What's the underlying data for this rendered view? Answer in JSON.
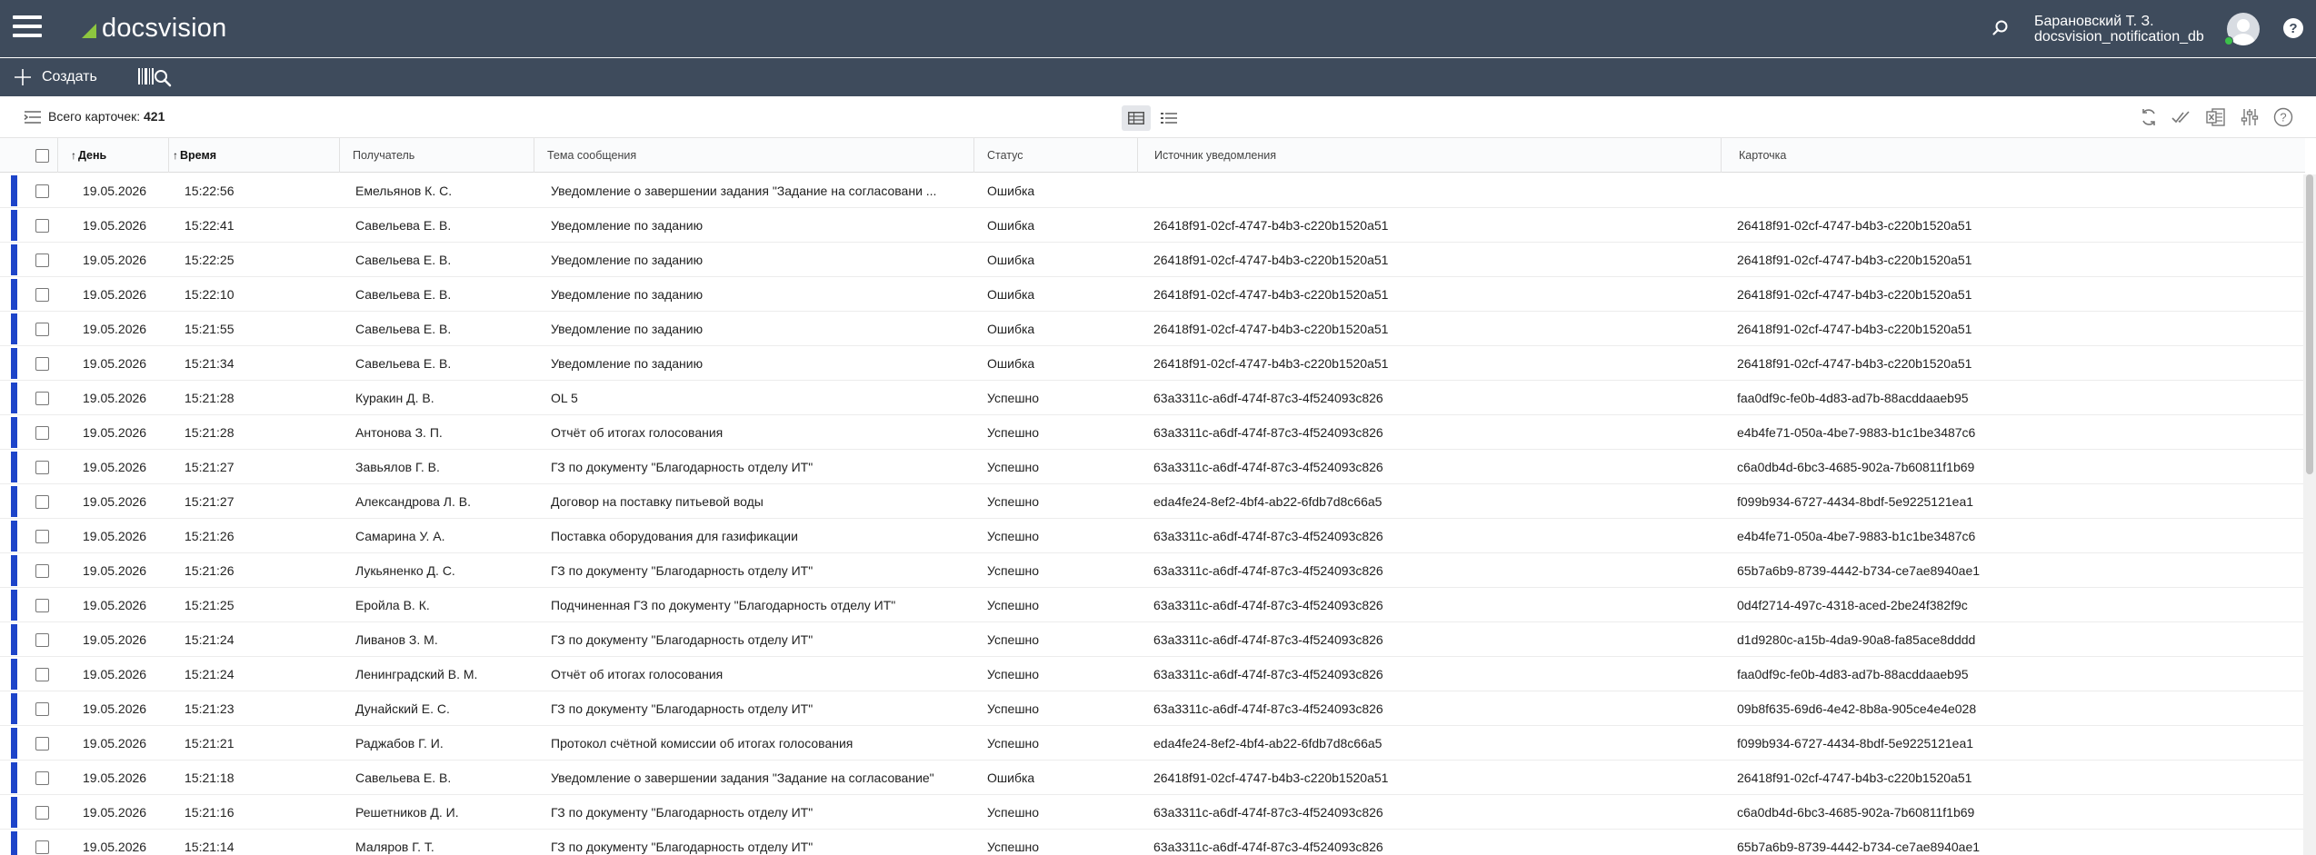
{
  "header": {
    "logo_text": "docsvision",
    "user_name": "Барановский Т. З.",
    "user_db": "docsvision_notification_db",
    "accent_color": "#8dc63f",
    "bg_color": "#3e4b5c"
  },
  "toolbar": {
    "create_label": "Создать"
  },
  "subheader": {
    "total_label": "Всего карточек:",
    "total_count": "421"
  },
  "table": {
    "columns": {
      "day": "День",
      "time": "Время",
      "recipient": "Получатель",
      "subject": "Тема сообщения",
      "status": "Статус",
      "source": "Источник уведомления",
      "card": "Карточка"
    },
    "rows": [
      {
        "day": "19.05.2026",
        "time": "15:22:56",
        "recipient": "Емельянов К. С.",
        "subject": "Уведомление о завершении задания \"Задание на согласовани ...",
        "status": "Ошибка",
        "source": "",
        "card": ""
      },
      {
        "day": "19.05.2026",
        "time": "15:22:41",
        "recipient": "Савельева Е. В.",
        "subject": "Уведомление по заданию",
        "status": "Ошибка",
        "source": "26418f91-02cf-4747-b4b3-c220b1520a51",
        "card": "26418f91-02cf-4747-b4b3-c220b1520a51"
      },
      {
        "day": "19.05.2026",
        "time": "15:22:25",
        "recipient": "Савельева Е. В.",
        "subject": "Уведомление по заданию",
        "status": "Ошибка",
        "source": "26418f91-02cf-4747-b4b3-c220b1520a51",
        "card": "26418f91-02cf-4747-b4b3-c220b1520a51"
      },
      {
        "day": "19.05.2026",
        "time": "15:22:10",
        "recipient": "Савельева Е. В.",
        "subject": "Уведомление по заданию",
        "status": "Ошибка",
        "source": "26418f91-02cf-4747-b4b3-c220b1520a51",
        "card": "26418f91-02cf-4747-b4b3-c220b1520a51"
      },
      {
        "day": "19.05.2026",
        "time": "15:21:55",
        "recipient": "Савельева Е. В.",
        "subject": "Уведомление по заданию",
        "status": "Ошибка",
        "source": "26418f91-02cf-4747-b4b3-c220b1520a51",
        "card": "26418f91-02cf-4747-b4b3-c220b1520a51"
      },
      {
        "day": "19.05.2026",
        "time": "15:21:34",
        "recipient": "Савельева Е. В.",
        "subject": "Уведомление по заданию",
        "status": "Ошибка",
        "source": "26418f91-02cf-4747-b4b3-c220b1520a51",
        "card": "26418f91-02cf-4747-b4b3-c220b1520a51"
      },
      {
        "day": "19.05.2026",
        "time": "15:21:28",
        "recipient": "Куракин Д. В.",
        "subject": "OL 5",
        "status": "Успешно",
        "source": "63a3311c-a6df-474f-87c3-4f524093c826",
        "card": "faa0df9c-fe0b-4d83-ad7b-88acddaaeb95"
      },
      {
        "day": "19.05.2026",
        "time": "15:21:28",
        "recipient": "Антонова З. П.",
        "subject": "Отчёт об итогах голосования",
        "status": "Успешно",
        "source": "63a3311c-a6df-474f-87c3-4f524093c826",
        "card": "e4b4fe71-050a-4be7-9883-b1c1be3487c6"
      },
      {
        "day": "19.05.2026",
        "time": "15:21:27",
        "recipient": "Завьялов Г. В.",
        "subject": "ГЗ по документу \"Благодарность отделу ИТ\"",
        "status": "Успешно",
        "source": "63a3311c-a6df-474f-87c3-4f524093c826",
        "card": "c6a0db4d-6bc3-4685-902a-7b60811f1b69"
      },
      {
        "day": "19.05.2026",
        "time": "15:21:27",
        "recipient": "Александрова Л. В.",
        "subject": "Договор на поставку питьевой воды",
        "status": "Успешно",
        "source": "eda4fe24-8ef2-4bf4-ab22-6fdb7d8c66a5",
        "card": "f099b934-6727-4434-8bdf-5e9225121ea1"
      },
      {
        "day": "19.05.2026",
        "time": "15:21:26",
        "recipient": "Самарина У. А.",
        "subject": "Поставка оборудования для газификации",
        "status": "Успешно",
        "source": "63a3311c-a6df-474f-87c3-4f524093c826",
        "card": "e4b4fe71-050a-4be7-9883-b1c1be3487c6"
      },
      {
        "day": "19.05.2026",
        "time": "15:21:26",
        "recipient": "Лукьяненко Д. С.",
        "subject": "ГЗ по документу \"Благодарность отделу ИТ\"",
        "status": "Успешно",
        "source": "63a3311c-a6df-474f-87c3-4f524093c826",
        "card": "65b7a6b9-8739-4442-b734-ce7ae8940ae1"
      },
      {
        "day": "19.05.2026",
        "time": "15:21:25",
        "recipient": "Еройла В. К.",
        "subject": "Подчиненная ГЗ по документу \"Благодарность отделу ИТ\"",
        "status": "Успешно",
        "source": "63a3311c-a6df-474f-87c3-4f524093c826",
        "card": "0d4f2714-497c-4318-aced-2be24f382f9c"
      },
      {
        "day": "19.05.2026",
        "time": "15:21:24",
        "recipient": "Ливанов З. М.",
        "subject": "ГЗ по документу \"Благодарность отделу ИТ\"",
        "status": "Успешно",
        "source": "63a3311c-a6df-474f-87c3-4f524093c826",
        "card": "d1d9280c-a15b-4da9-90a8-fa85ace8dddd"
      },
      {
        "day": "19.05.2026",
        "time": "15:21:24",
        "recipient": "Ленинградский В. М.",
        "subject": "Отчёт об итогах голосования",
        "status": "Успешно",
        "source": "63a3311c-a6df-474f-87c3-4f524093c826",
        "card": "faa0df9c-fe0b-4d83-ad7b-88acddaaeb95"
      },
      {
        "day": "19.05.2026",
        "time": "15:21:23",
        "recipient": "Дунайский Е. С.",
        "subject": "ГЗ по документу \"Благодарность отделу ИТ\"",
        "status": "Успешно",
        "source": "63a3311c-a6df-474f-87c3-4f524093c826",
        "card": "09b8f635-69d6-4e42-8b8a-905ce4e4e028"
      },
      {
        "day": "19.05.2026",
        "time": "15:21:21",
        "recipient": "Раджабов Г. И.",
        "subject": "Протокол счётной комиссии об итогах голосования",
        "status": "Успешно",
        "source": "eda4fe24-8ef2-4bf4-ab22-6fdb7d8c66a5",
        "card": "f099b934-6727-4434-8bdf-5e9225121ea1"
      },
      {
        "day": "19.05.2026",
        "time": "15:21:18",
        "recipient": "Савельева Е. В.",
        "subject": "Уведомление о завершении задания \"Задание на согласование\"",
        "status": "Ошибка",
        "source": "26418f91-02cf-4747-b4b3-c220b1520a51",
        "card": "26418f91-02cf-4747-b4b3-c220b1520a51"
      },
      {
        "day": "19.05.2026",
        "time": "15:21:16",
        "recipient": "Решетников Д. И.",
        "subject": "ГЗ по документу \"Благодарность отделу ИТ\"",
        "status": "Успешно",
        "source": "63a3311c-a6df-474f-87c3-4f524093c826",
        "card": "c6a0db4d-6bc3-4685-902a-7b60811f1b69"
      },
      {
        "day": "19.05.2026",
        "time": "15:21:14",
        "recipient": "Маляров Г. Т.",
        "subject": "ГЗ по документу \"Благодарность отделу ИТ\"",
        "status": "Успешно",
        "source": "63a3311c-a6df-474f-87c3-4f524093c826",
        "card": "65b7a6b9-8739-4442-b734-ce7ae8940ae1"
      }
    ]
  },
  "icons": {
    "menu": "hamburger-icon",
    "search": "search-icon",
    "help": "help-icon",
    "create": "plus-icon",
    "barcode_search": "barcode-search-icon",
    "collapse": "collapse-icon",
    "table_view": "table-view-icon",
    "list_view": "list-view-icon",
    "refresh": "refresh-icon",
    "mark_read": "double-check-icon",
    "excel": "excel-export-icon",
    "settings": "column-settings-icon"
  },
  "colors": {
    "row_marker": "#1d44c9"
  }
}
